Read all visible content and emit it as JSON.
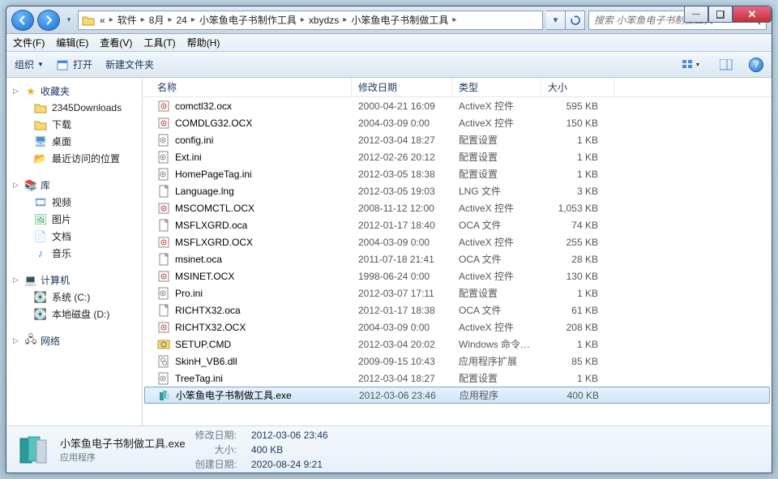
{
  "titlebar": {
    "min": "—",
    "max": "□",
    "close": "✕"
  },
  "nav": {
    "crumbs": [
      "«",
      "软件",
      "8月",
      "24",
      "小笨鱼电子书制作工具",
      "xbydzs",
      "小笨鱼电子书制做工具"
    ],
    "search_placeholder": "搜索 小笨鱼电子书制做工具"
  },
  "menu": {
    "file": "文件(F)",
    "edit": "编辑(E)",
    "view": "查看(V)",
    "tools": "工具(T)",
    "help": "帮助(H)"
  },
  "toolbar": {
    "organize": "组织",
    "open": "打开",
    "newfolder": "新建文件夹"
  },
  "sidebar": {
    "fav": {
      "head": "收藏夹",
      "items": [
        "2345Downloads",
        "下载",
        "桌面",
        "最近访问的位置"
      ]
    },
    "lib": {
      "head": "库",
      "items": [
        "视频",
        "图片",
        "文档",
        "音乐"
      ]
    },
    "comp": {
      "head": "计算机",
      "items": [
        "系统 (C:)",
        "本地磁盘 (D:)"
      ]
    },
    "net": {
      "head": "网络"
    }
  },
  "columns": {
    "name": "名称",
    "date": "修改日期",
    "type": "类型",
    "size": "大小"
  },
  "files": [
    {
      "name": "comctl32.ocx",
      "date": "2000-04-21 16:09",
      "type": "ActiveX 控件",
      "size": "595 KB",
      "icon": "ocx"
    },
    {
      "name": "COMDLG32.OCX",
      "date": "2004-03-09 0:00",
      "type": "ActiveX 控件",
      "size": "150 KB",
      "icon": "ocx"
    },
    {
      "name": "config.ini",
      "date": "2012-03-04 18:27",
      "type": "配置设置",
      "size": "1 KB",
      "icon": "ini"
    },
    {
      "name": "Ext.ini",
      "date": "2012-02-26 20:12",
      "type": "配置设置",
      "size": "1 KB",
      "icon": "ini"
    },
    {
      "name": "HomePageTag.ini",
      "date": "2012-03-05 18:38",
      "type": "配置设置",
      "size": "1 KB",
      "icon": "ini"
    },
    {
      "name": "Language.lng",
      "date": "2012-03-05 19:03",
      "type": "LNG 文件",
      "size": "3 KB",
      "icon": "file"
    },
    {
      "name": "MSCOMCTL.OCX",
      "date": "2008-11-12 12:00",
      "type": "ActiveX 控件",
      "size": "1,053 KB",
      "icon": "ocx"
    },
    {
      "name": "MSFLXGRD.oca",
      "date": "2012-01-17 18:40",
      "type": "OCA 文件",
      "size": "74 KB",
      "icon": "file"
    },
    {
      "name": "MSFLXGRD.OCX",
      "date": "2004-03-09 0:00",
      "type": "ActiveX 控件",
      "size": "255 KB",
      "icon": "ocx"
    },
    {
      "name": "msinet.oca",
      "date": "2011-07-18 21:41",
      "type": "OCA 文件",
      "size": "28 KB",
      "icon": "file"
    },
    {
      "name": "MSINET.OCX",
      "date": "1998-06-24 0:00",
      "type": "ActiveX 控件",
      "size": "130 KB",
      "icon": "ocx"
    },
    {
      "name": "Pro.ini",
      "date": "2012-03-07 17:11",
      "type": "配置设置",
      "size": "1 KB",
      "icon": "ini"
    },
    {
      "name": "RICHTX32.oca",
      "date": "2012-01-17 18:38",
      "type": "OCA 文件",
      "size": "61 KB",
      "icon": "file"
    },
    {
      "name": "RICHTX32.OCX",
      "date": "2004-03-09 0:00",
      "type": "ActiveX 控件",
      "size": "208 KB",
      "icon": "ocx"
    },
    {
      "name": "SETUP.CMD",
      "date": "2012-03-04 20:02",
      "type": "Windows 命令脚本",
      "size": "1 KB",
      "icon": "cmd"
    },
    {
      "name": "SkinH_VB6.dll",
      "date": "2009-09-15 10:43",
      "type": "应用程序扩展",
      "size": "85 KB",
      "icon": "dll"
    },
    {
      "name": "TreeTag.ini",
      "date": "2012-03-04 18:27",
      "type": "配置设置",
      "size": "1 KB",
      "icon": "ini"
    },
    {
      "name": "小笨鱼电子书制做工具.exe",
      "date": "2012-03-06 23:46",
      "type": "应用程序",
      "size": "400 KB",
      "icon": "exe",
      "selected": true
    }
  ],
  "details": {
    "filename": "小笨鱼电子书制做工具.exe",
    "filetype": "应用程序",
    "mod_label": "修改日期:",
    "mod_val": "2012-03-06 23:46",
    "size_label": "大小:",
    "size_val": "400 KB",
    "create_label": "创建日期:",
    "create_val": "2020-08-24 9:21"
  }
}
